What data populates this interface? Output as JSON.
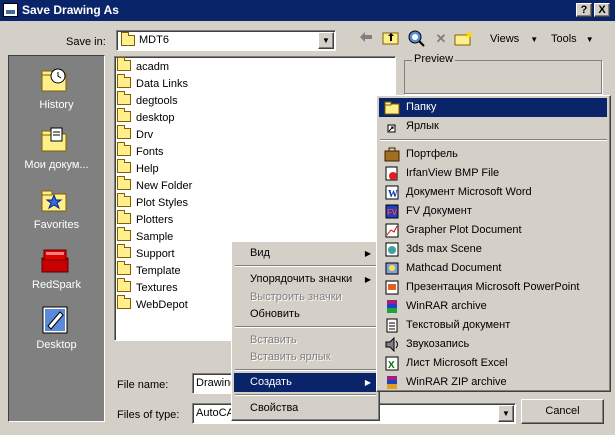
{
  "window": {
    "title": "Save Drawing As",
    "help_button": "?",
    "close_button": "X"
  },
  "toolbar": {
    "save_in_label": "Save in:",
    "save_in_value": "MDT6",
    "views_label": "Views",
    "tools_label": "Tools"
  },
  "places": [
    {
      "label": "History",
      "icon": "history-icon"
    },
    {
      "label": "Мои докум...",
      "icon": "my-documents-icon"
    },
    {
      "label": "Favorites",
      "icon": "favorites-icon"
    },
    {
      "label": "RedSpark",
      "icon": "redspark-icon"
    },
    {
      "label": "Desktop",
      "icon": "desktop-icon"
    }
  ],
  "files": [
    "acadm",
    "Data Links",
    "degtools",
    "desktop",
    "Drv",
    "Fonts",
    "Help",
    "New Folder",
    "Plot Styles",
    "Plotters",
    "Sample",
    "Support",
    "Template",
    "Textures",
    "WebDepot"
  ],
  "preview_label": "Preview",
  "file_name": {
    "label": "File name:",
    "value": "Drawing"
  },
  "file_type": {
    "label": "Files of type:",
    "value": "AutoCA"
  },
  "cancel_label": "Cancel",
  "context_menu": {
    "items": [
      {
        "label": "Вид",
        "disabled": false,
        "submenu": true
      },
      {
        "label": "Упорядочить значки",
        "disabled": false,
        "submenu": true
      },
      {
        "label": "Выстроить значки",
        "disabled": true,
        "submenu": false
      },
      {
        "label": "Обновить",
        "disabled": false,
        "submenu": false
      },
      {
        "label": "Вставить",
        "disabled": true,
        "submenu": false
      },
      {
        "label": "Вставить ярлык",
        "disabled": true,
        "submenu": false
      },
      {
        "label": "Создать",
        "disabled": false,
        "submenu": true,
        "highlighted": true
      },
      {
        "label": "Свойства",
        "disabled": false,
        "submenu": false
      }
    ]
  },
  "new_submenu": {
    "items": [
      {
        "label": "Папку",
        "icon": "folder-icon",
        "highlighted": true
      },
      {
        "label": "Ярлык",
        "icon": "shortcut-icon"
      },
      {
        "label": "Портфель",
        "icon": "briefcase-icon"
      },
      {
        "label": "IrfanView BMP File",
        "icon": "irfanview-icon"
      },
      {
        "label": "Документ Microsoft Word",
        "icon": "word-icon"
      },
      {
        "label": "FV Документ",
        "icon": "fv-document-icon"
      },
      {
        "label": "Grapher Plot Document",
        "icon": "grapher-icon"
      },
      {
        "label": "3ds max Scene",
        "icon": "3dsmax-icon"
      },
      {
        "label": "Mathcad Document",
        "icon": "mathcad-icon"
      },
      {
        "label": "Презентация Microsoft PowerPoint",
        "icon": "powerpoint-icon"
      },
      {
        "label": "WinRAR archive",
        "icon": "winrar-icon"
      },
      {
        "label": "Текстовый документ",
        "icon": "text-document-icon"
      },
      {
        "label": "Звукозапись",
        "icon": "sound-icon"
      },
      {
        "label": "Лист Microsoft Excel",
        "icon": "excel-icon"
      },
      {
        "label": "WinRAR ZIP archive",
        "icon": "winrar-zip-icon"
      }
    ]
  }
}
